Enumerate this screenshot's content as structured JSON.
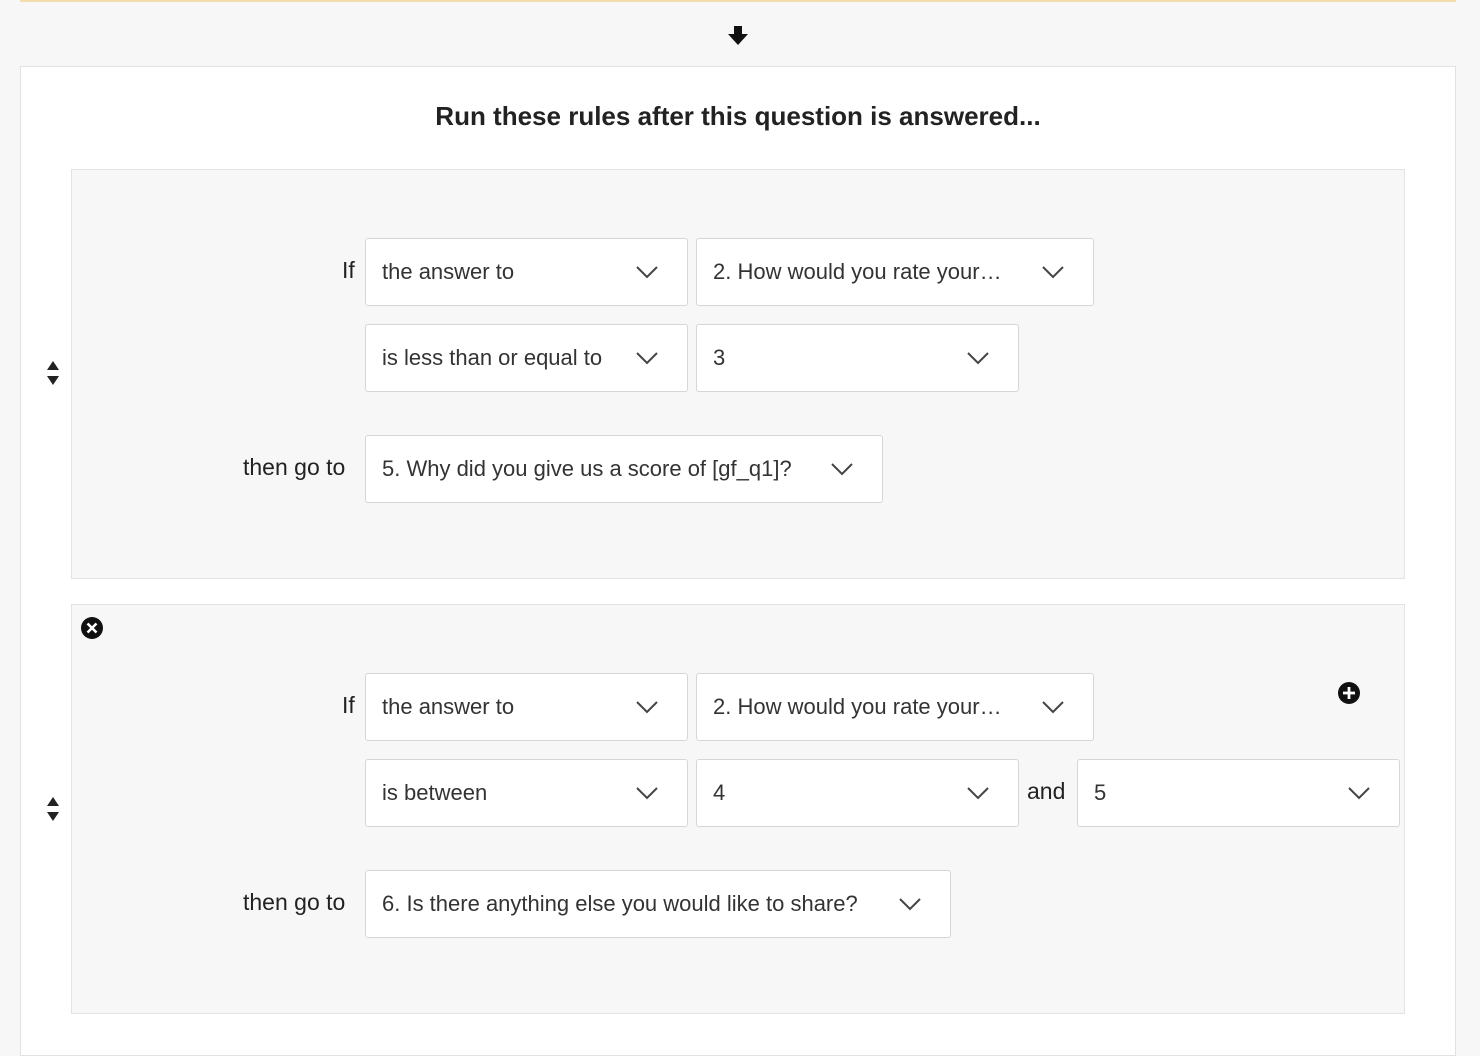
{
  "title": "Run these rules after this question is answered...",
  "icons": {
    "flow_arrow": "arrow-down-icon",
    "sort": "sort-icon",
    "remove": "remove-circle-icon",
    "add": "add-circle-icon",
    "dropdown": "chevron-down-icon"
  },
  "rules": [
    {
      "if_label": "If",
      "subject": "the answer to",
      "question": "2. How would you rate your…",
      "operator": "is less than or equal to",
      "value": "3",
      "then_label": "then go to",
      "target": "5. Why did you give us a score of [gf_q1]?"
    },
    {
      "if_label": "If",
      "subject": "the answer to",
      "question": "2. How would you rate your…",
      "operator": "is between",
      "value": "4",
      "and_label": "and",
      "value2": "5",
      "then_label": "then go to",
      "target": "6. Is there anything else you would like to share?"
    }
  ]
}
